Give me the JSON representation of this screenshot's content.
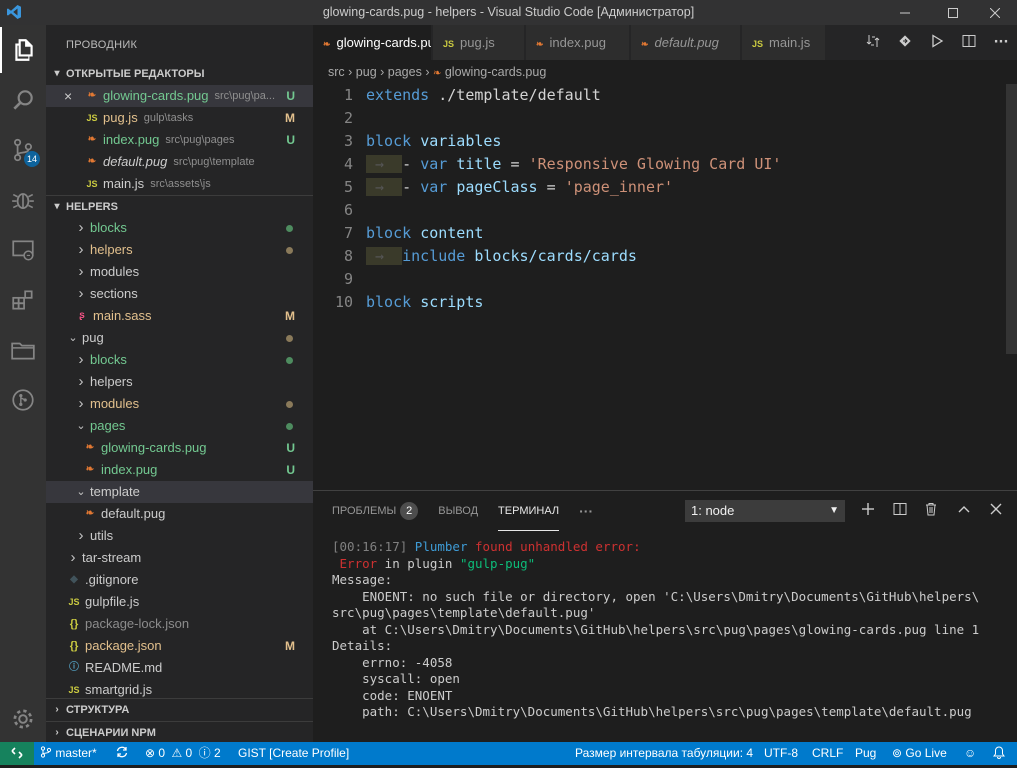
{
  "window": {
    "title": "glowing-cards.pug - helpers - Visual Studio Code [Администратор]",
    "logo_icon": "vscode-logo",
    "minimize_icon": "minimize-icon",
    "maximize_icon": "maximize-icon",
    "close_icon": "close-icon"
  },
  "activity_bar": {
    "items": [
      {
        "icon": "files-icon",
        "active": true
      },
      {
        "icon": "search-icon"
      },
      {
        "icon": "source-control-icon",
        "badge": "14"
      },
      {
        "icon": "debug-icon"
      },
      {
        "icon": "remote-explorer-icon"
      },
      {
        "icon": "extensions-icon"
      },
      {
        "icon": "folder-icon"
      },
      {
        "icon": "git-graph-icon"
      }
    ],
    "settings_icon": "gear-icon"
  },
  "sidebar": {
    "title": "ПРОВОДНИК",
    "open_editors": {
      "header": "ОТКРЫТЫЕ РЕДАКТОРЫ",
      "items": [
        {
          "name": "glowing-cards.pug",
          "desc": "src\\pug\\pa...",
          "status": "U",
          "type": "pug",
          "close": "×"
        },
        {
          "name": "pug.js",
          "desc": "gulp\\tasks",
          "status": "M",
          "type": "js"
        },
        {
          "name": "index.pug",
          "desc": "src\\pug\\pages",
          "status": "U",
          "type": "pug"
        },
        {
          "name": "default.pug",
          "desc": "src\\pug\\template",
          "status": "",
          "type": "pug"
        },
        {
          "name": "main.js",
          "desc": "src\\assets\\js",
          "status": "",
          "type": "js"
        }
      ]
    },
    "helpers": {
      "header": "HELPERS",
      "items": [
        {
          "name": "blocks",
          "kind": "folder",
          "depth": 2,
          "color": "green",
          "dot": "green"
        },
        {
          "name": "helpers",
          "kind": "folder",
          "depth": 2,
          "color": "yellow",
          "dot": "gray"
        },
        {
          "name": "modules",
          "kind": "folder",
          "depth": 2,
          "color": "normal"
        },
        {
          "name": "sections",
          "kind": "folder",
          "depth": 2,
          "color": "normal"
        },
        {
          "name": "main.sass",
          "kind": "sass",
          "depth": 2,
          "color": "yellow",
          "status": "M"
        },
        {
          "name": "pug",
          "kind": "folder-open",
          "depth": 1,
          "color": "normal",
          "dot": "gray"
        },
        {
          "name": "blocks",
          "kind": "folder",
          "depth": 2,
          "color": "green",
          "dot": "green"
        },
        {
          "name": "helpers",
          "kind": "folder",
          "depth": 2,
          "color": "normal"
        },
        {
          "name": "modules",
          "kind": "folder",
          "depth": 2,
          "color": "yellow",
          "dot": "gray"
        },
        {
          "name": "pages",
          "kind": "folder-open",
          "depth": 2,
          "color": "green",
          "dot": "green"
        },
        {
          "name": "glowing-cards.pug",
          "kind": "pug",
          "depth": 3,
          "color": "green",
          "status": "U"
        },
        {
          "name": "index.pug",
          "kind": "pug",
          "depth": 3,
          "color": "green",
          "status": "U"
        },
        {
          "name": "template",
          "kind": "folder-open",
          "depth": 2,
          "color": "normal",
          "selected": true
        },
        {
          "name": "default.pug",
          "kind": "pug",
          "depth": 3,
          "color": "normal"
        },
        {
          "name": "utils",
          "kind": "folder",
          "depth": 2,
          "color": "normal"
        },
        {
          "name": "tar-stream",
          "kind": "folder",
          "depth": 1,
          "color": "normal"
        },
        {
          "name": ".gitignore",
          "kind": "git",
          "depth": 1,
          "color": "normal"
        },
        {
          "name": "gulpfile.js",
          "kind": "js",
          "depth": 1,
          "color": "normal"
        },
        {
          "name": "package-lock.json",
          "kind": "json",
          "depth": 1,
          "color": "gray"
        },
        {
          "name": "package.json",
          "kind": "json",
          "depth": 1,
          "color": "yellow",
          "status": "M"
        },
        {
          "name": "README.md",
          "kind": "info",
          "depth": 1,
          "color": "normal"
        },
        {
          "name": "smartgrid.js",
          "kind": "js",
          "depth": 1,
          "color": "normal"
        }
      ]
    },
    "outline_header": "СТРУКТУРА",
    "npm_header": "СЦЕНАРИИ NPM"
  },
  "tabs": [
    {
      "label": "glowing-cards.pug",
      "type": "pug",
      "active": true
    },
    {
      "label": "pug.js",
      "type": "js"
    },
    {
      "label": "index.pug",
      "type": "pug"
    },
    {
      "label": "default.pug",
      "type": "pug",
      "italic": true
    },
    {
      "label": "main.js",
      "type": "js"
    }
  ],
  "tab_actions": [
    "compare-icon",
    "go-to-file-icon",
    "run-icon",
    "split-editor-icon",
    "more-icon"
  ],
  "breadcrumb": [
    "src",
    "pug",
    "pages",
    "glowing-cards.pug"
  ],
  "code": {
    "lines": [
      {
        "n": "1"
      },
      {
        "n": "2"
      },
      {
        "n": "3"
      },
      {
        "n": "4"
      },
      {
        "n": "5"
      },
      {
        "n": "6"
      },
      {
        "n": "7"
      },
      {
        "n": "8"
      },
      {
        "n": "9"
      },
      {
        "n": "10"
      }
    ],
    "tokens": {
      "extends": "extends",
      "extends_path": "./template/default",
      "block": "block",
      "variables": "variables",
      "dash": "-",
      "var": "var",
      "title": "title",
      "eq": "=",
      "title_val": "'Responsive Glowing Card UI'",
      "pageClass": "pageClass",
      "pageClass_val": "'page_inner'",
      "content": "content",
      "include": "include",
      "include_path": "blocks/cards/cards",
      "scripts": "scripts",
      "indent_arrow": "→"
    }
  },
  "panel": {
    "problems_label": "ПРОБЛЕМЫ",
    "problems_count": "2",
    "output_label": "ВЫВОД",
    "terminal_label": "ТЕРМИНАЛ",
    "more": "···",
    "terminal_select": "1: node",
    "actions": [
      "plus-icon",
      "split-terminal-icon",
      "trash-icon",
      "chevron-up-icon",
      "close-icon"
    ],
    "terminal": {
      "bracket_open": "[",
      "time": "00:16:17",
      "bracket_close": "]",
      "plumber": " Plumber",
      "found": " found unhandled error:",
      "error_word": " Error",
      "in_plugin": " in plugin ",
      "plugin": "\"gulp-pug\"",
      "line3": "Message:",
      "line4": "    ENOENT: no such file or directory, open 'C:\\Users\\Dmitry\\Documents\\GitHub\\helpers\\",
      "line5": "src\\pug\\pages\\template\\default.pug'",
      "line6": "    at C:\\Users\\Dmitry\\Documents\\GitHub\\helpers\\src\\pug\\pages\\glowing-cards.pug line 1",
      "line7": "Details:",
      "line8": "    errno: -4058",
      "line9": "    syscall: open",
      "line10": "    code: ENOENT",
      "line11": "    path: C:\\Users\\Dmitry\\Documents\\GitHub\\helpers\\src\\pug\\pages\\template\\default.pug"
    }
  },
  "statusbar": {
    "remote_icon": "remote-icon",
    "branch": "master*",
    "sync_icon": "sync-icon",
    "errors": "0",
    "warnings": "0",
    "info": "2",
    "gist": "GIST [Create Profile]",
    "tab_size": "Размер интервала табуляции: 4",
    "encoding": "UTF-8",
    "eol": "CRLF",
    "language": "Pug",
    "go_live": "Go Live",
    "feedback_icon": "smiley-icon",
    "bell_icon": "bell-icon"
  },
  "colors": {
    "accent": "#007acc",
    "remote": "#16825d",
    "untracked": "#73c991",
    "modified": "#e2c08d"
  }
}
